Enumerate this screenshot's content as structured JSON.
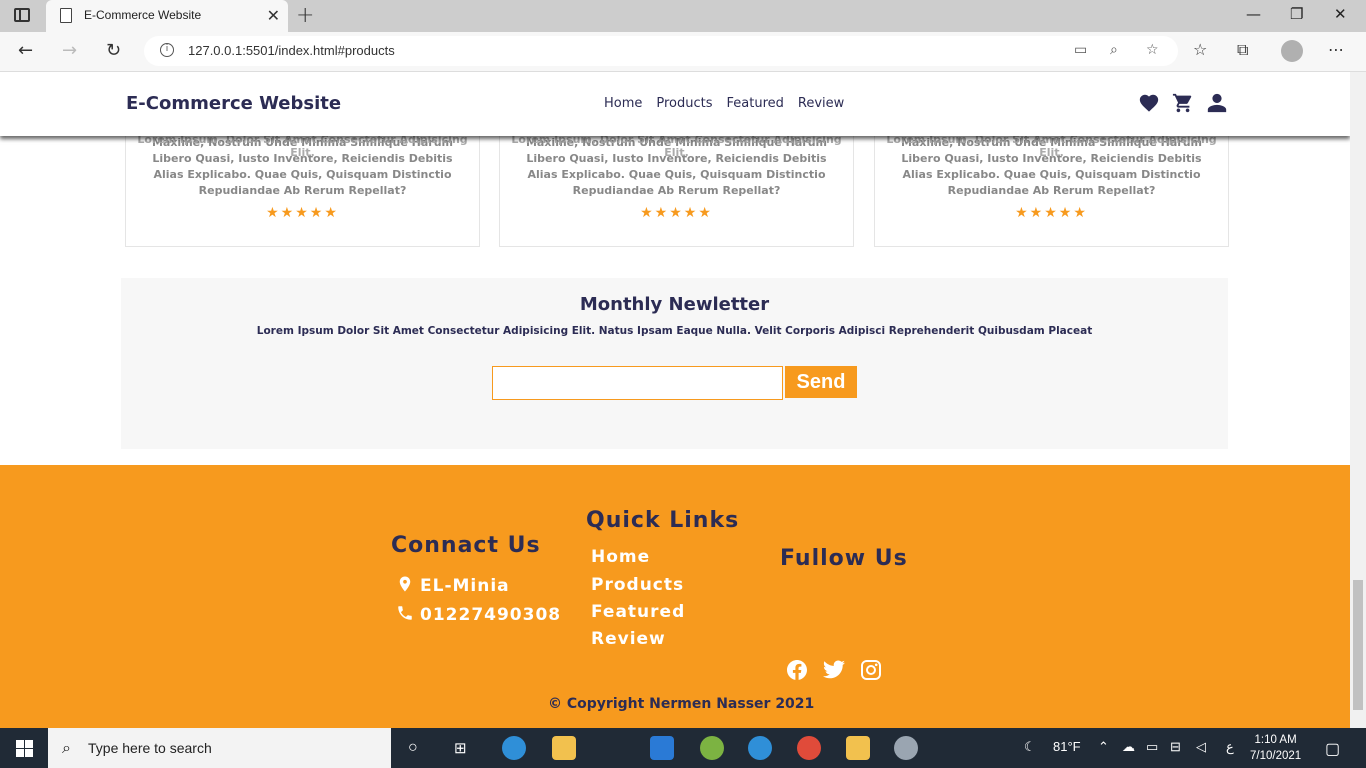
{
  "browser": {
    "tab_title": "E-Commerce Website",
    "url": "127.0.0.1:5501/index.html#products"
  },
  "header": {
    "logo": "E-Commerce Website",
    "nav": [
      "Home",
      "Products",
      "Featured",
      "Review"
    ]
  },
  "products": {
    "cards": [
      {
        "desc_top": "Lorem Ipsum, Dolor Sit Amet Consectetur Adipisicing Elit.",
        "desc": "Maxime, Nostrum Unde Minima Similique Harum Libero Quasi, Iusto Inventore, Reiciendis Debitis Alias Explicabo. Quae Quis, Quisquam Distinctio Repudiandae Ab Rerum Repellat?",
        "rating": 5
      },
      {
        "desc_top": "Lorem Ipsum, Dolor Sit Amet Consectetur Adipisicing Elit.",
        "desc": "Maxime, Nostrum Unde Minima Similique Harum Libero Quasi, Iusto Inventore, Reiciendis Debitis Alias Explicabo. Quae Quis, Quisquam Distinctio Repudiandae Ab Rerum Repellat?",
        "rating": 5
      },
      {
        "desc_top": "Lorem Ipsum, Dolor Sit Amet Consectetur Adipisicing Elit.",
        "desc": "Maxime, Nostrum Unde Minima Similique Harum Libero Quasi, Iusto Inventore, Reiciendis Debitis Alias Explicabo. Quae Quis, Quisquam Distinctio Repudiandae Ab Rerum Repellat?",
        "rating": 5
      }
    ],
    "stars": "★★★★★"
  },
  "newsletter": {
    "title": "Monthly Newletter",
    "text": "Lorem Ipsum Dolor Sit Amet Consectetur Adipisicing Elit. Natus Ipsam Eaque Nulla. Velit Corporis Adipisci Reprehenderit Quibusdam Placeat",
    "input_value": "",
    "button": "Send"
  },
  "footer": {
    "contact_title": "Connact Us",
    "location": "EL-Minia",
    "phone": "01227490308",
    "links_title": "Quick Links",
    "links": [
      "Home",
      "Products",
      "Featured",
      "Review"
    ],
    "follow_title": "Fullow Us",
    "copyright": "© Copyright Nermen Nasser 2021"
  },
  "taskbar": {
    "search_placeholder": "Type here to search",
    "weather": "81°F",
    "lang": "ع",
    "time": "1:10 AM",
    "date": "7/10/2021"
  },
  "colors": {
    "accent": "#f79a1e",
    "navy": "#2c2c54"
  }
}
